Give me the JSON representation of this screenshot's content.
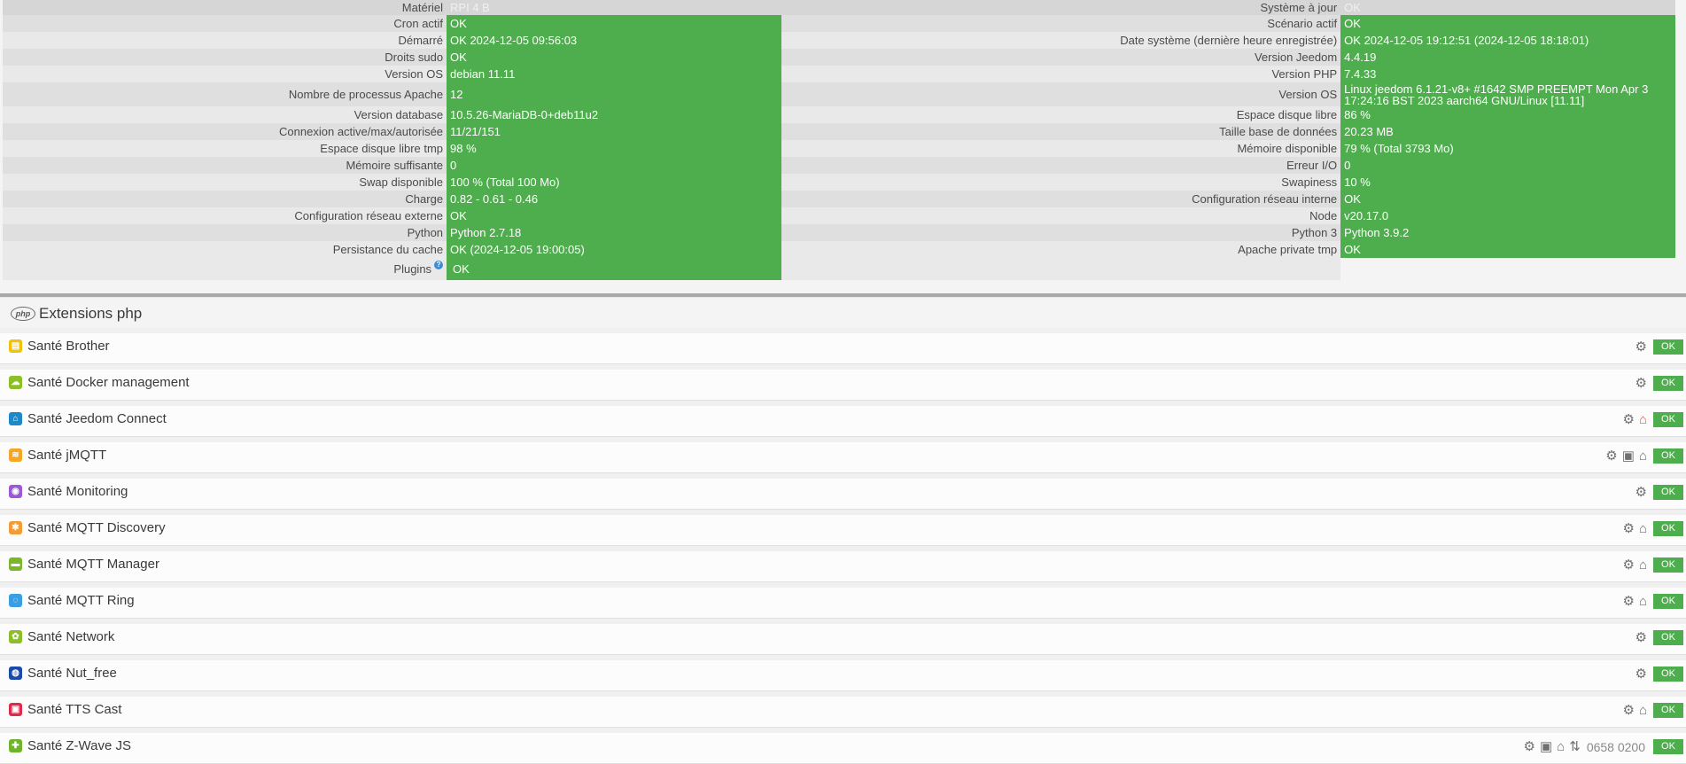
{
  "health": {
    "rows": [
      {
        "l1": "Matériel",
        "v1": "RPI 4 B",
        "l2": "Système à jour",
        "v2": "OK"
      },
      {
        "l1": "Cron actif",
        "v1": "OK",
        "l2": "Scénario actif",
        "v2": "OK"
      },
      {
        "l1": "Démarré",
        "v1": "OK 2024-12-05 09:56:03",
        "l2": "Date système (dernière heure enregistrée)",
        "v2": "OK 2024-12-05 19:12:51 (2024-12-05 18:18:01)"
      },
      {
        "l1": "Droits sudo",
        "v1": "OK",
        "l2": "Version Jeedom",
        "v2": "4.4.19"
      },
      {
        "l1": "Version OS",
        "v1": "debian 11.11",
        "l2": "Version PHP",
        "v2": "7.4.33"
      },
      {
        "l1": "Nombre de processus Apache",
        "v1": "12",
        "l2": "Version OS",
        "v2": "Linux jeedom 6.1.21-v8+ #1642 SMP PREEMPT Mon Apr 3 17:24:16 BST 2023 aarch64 GNU/Linux [11.11]"
      },
      {
        "l1": "Version database",
        "v1": "10.5.26-MariaDB-0+deb11u2",
        "l2": "Espace disque libre",
        "v2": "86 %"
      },
      {
        "l1": "Connexion active/max/autorisée",
        "v1": "11/21/151",
        "l2": "Taille base de données",
        "v2": "20.23 MB"
      },
      {
        "l1": "Espace disque libre tmp",
        "v1": "98 %",
        "l2": "Mémoire disponible",
        "v2": "79 % (Total 3793 Mo)"
      },
      {
        "l1": "Mémoire suffisante",
        "v1": "0",
        "l2": "Erreur I/O",
        "v2": "0"
      },
      {
        "l1": "Swap disponible",
        "v1": "100 % (Total 100 Mo)",
        "l2": "Swapiness",
        "v2": "10 %"
      },
      {
        "l1": "Charge",
        "v1": "0.82 - 0.61 - 0.46",
        "l2": "Configuration réseau interne",
        "v2": "OK"
      },
      {
        "l1": "Configuration réseau externe",
        "v1": "OK",
        "l2": "Node",
        "v2": "v20.17.0"
      },
      {
        "l1": "Python",
        "v1": "Python 2.7.18",
        "l2": "Python 3",
        "v2": "Python 3.9.2"
      },
      {
        "l1": "Persistance du cache",
        "v1": "OK (2024-12-05 19:00:05)",
        "l2": "Apache private tmp",
        "v2": "OK"
      }
    ],
    "plugins_label": "Plugins",
    "plugins_value": "OK",
    "help_glyph": "?"
  },
  "section": {
    "title": "Extensions php",
    "badge": "php"
  },
  "plugins": [
    {
      "name": "Santé Brother",
      "color": "#f2c10d",
      "glyph": "▤",
      "actions": [
        "cogs"
      ],
      "code": ""
    },
    {
      "name": "Santé Docker management",
      "color": "#8cbf26",
      "glyph": "☁",
      "actions": [
        "cogs"
      ],
      "code": ""
    },
    {
      "name": "Santé Jeedom Connect",
      "color": "#1f88c8",
      "glyph": "⌂",
      "actions": [
        "cogs",
        "bank-red"
      ],
      "code": ""
    },
    {
      "name": "Santé jMQTT",
      "color": "#f5a623",
      "glyph": "≋",
      "actions": [
        "cogs",
        "medkit",
        "bank"
      ],
      "code": ""
    },
    {
      "name": "Santé Monitoring",
      "color": "#9b59d6",
      "glyph": "◉",
      "actions": [
        "cogs"
      ],
      "code": ""
    },
    {
      "name": "Santé MQTT Discovery",
      "color": "#f39c33",
      "glyph": "✱",
      "actions": [
        "cogs",
        "bank"
      ],
      "code": ""
    },
    {
      "name": "Santé MQTT Manager",
      "color": "#7ab827",
      "glyph": "▬",
      "actions": [
        "cogs",
        "bank"
      ],
      "code": ""
    },
    {
      "name": "Santé MQTT Ring",
      "color": "#3a9ee0",
      "glyph": "◌",
      "actions": [
        "cogs",
        "bank"
      ],
      "code": ""
    },
    {
      "name": "Santé Network",
      "color": "#8cbf26",
      "glyph": "✿",
      "actions": [
        "cogs"
      ],
      "code": ""
    },
    {
      "name": "Santé Nut_free",
      "color": "#1c4aa8",
      "glyph": "◍",
      "actions": [
        "cogs"
      ],
      "code": ""
    },
    {
      "name": "Santé TTS Cast",
      "color": "#e02a4b",
      "glyph": "▣",
      "actions": [
        "cogs",
        "bank"
      ],
      "code": ""
    },
    {
      "name": "Santé Z-Wave JS",
      "color": "#6fb52c",
      "glyph": "✚",
      "actions": [
        "cogs",
        "medkit",
        "bank",
        "sort"
      ],
      "code": "0658 0200"
    }
  ],
  "status_ok": "OK",
  "icons": {
    "cogs": "⚙",
    "medkit": "▣",
    "bank": "⌂",
    "bank-red": "⌂",
    "sort": "⇅"
  },
  "colors": {
    "ok_green": "#4ead4d",
    "alert_red": "#e25a5a"
  }
}
